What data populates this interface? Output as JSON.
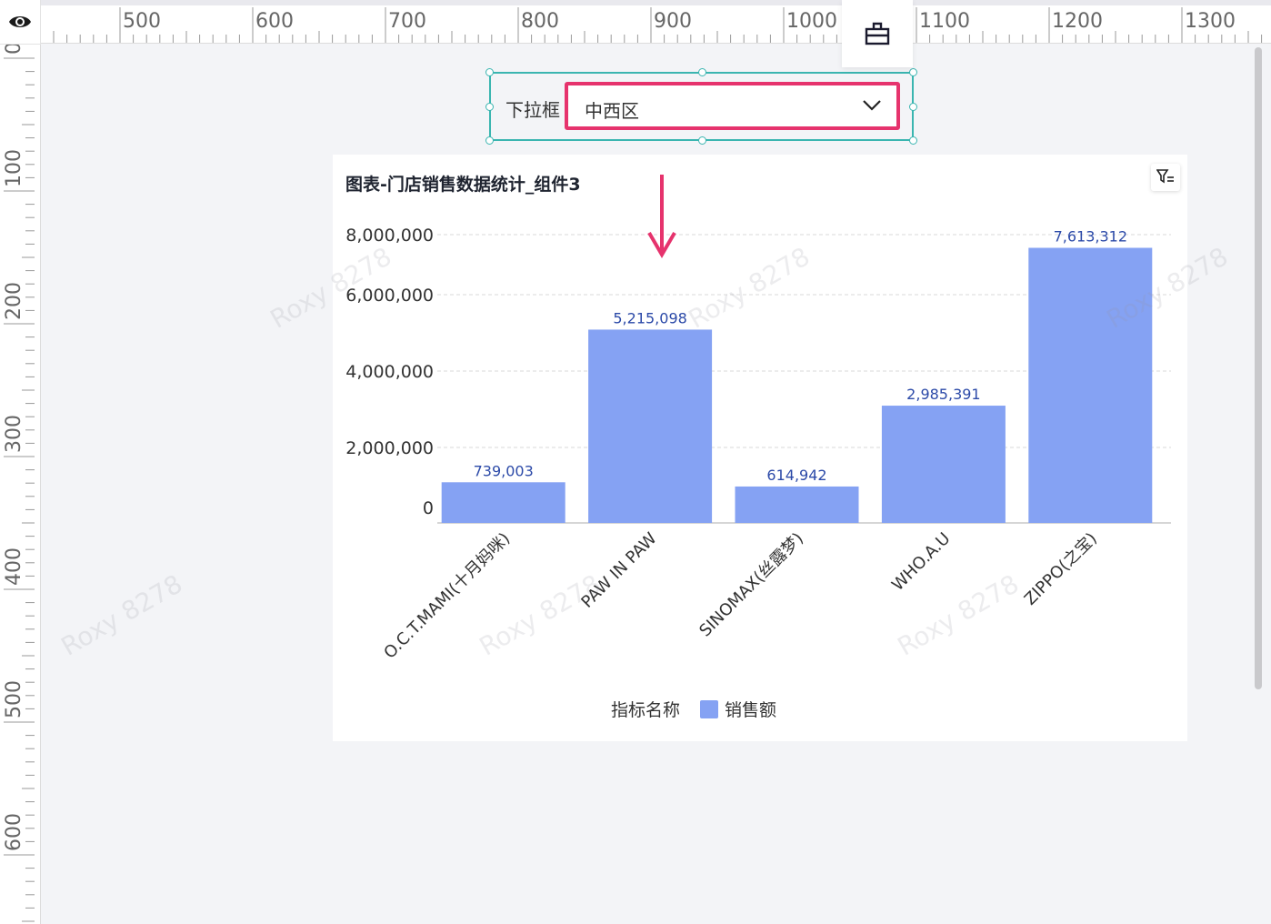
{
  "ruler": {
    "top_labels": [
      "500",
      "600",
      "700",
      "800",
      "900",
      "1000",
      "1100",
      "1200",
      "1300"
    ],
    "left_labels": [
      "0",
      "100",
      "200",
      "300",
      "400",
      "500",
      "600"
    ]
  },
  "toolbar": {
    "icon": "dashboard-panel-icon"
  },
  "dropdown": {
    "label": "下拉框",
    "value": "中西区",
    "highlight_color": "#e6336d",
    "selection_color": "#3ab5b0"
  },
  "chart": {
    "title": "图表-门店销售数据统计_组件3",
    "legend_title": "指标名称",
    "legend_item": "销售额",
    "watermark": "Roxy 8278"
  },
  "chart_data": {
    "type": "bar",
    "categories": [
      "O.C.T.MAMI(十月妈咪)",
      "PAW IN PAW",
      "SINOMAX(丝露梦)",
      "WHO.A.U",
      "ZIPPO(之宝)"
    ],
    "series": [
      {
        "name": "销售额",
        "values": [
          739003,
          5215098,
          614942,
          2985391,
          7613312
        ],
        "color": "#85a2f3"
      }
    ],
    "value_labels": [
      "739,003",
      "5,215,098",
      "614,942",
      "2,985,391",
      "7,613,312"
    ],
    "y_ticks": [
      "0",
      "2,000,000",
      "4,000,000",
      "6,000,000",
      "8,000,000"
    ],
    "ylim": [
      0,
      8000000
    ],
    "grid": true,
    "legend_position": "bottom"
  }
}
